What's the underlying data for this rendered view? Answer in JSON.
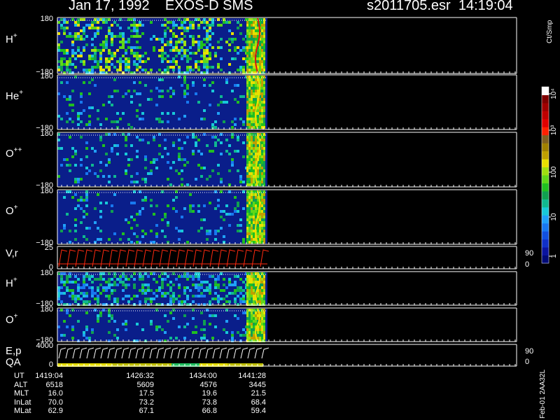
{
  "header": {
    "left_title": "Jan 17, 1992    EXOS-D SMS",
    "right_title": "s2011705.esr  14:19:04"
  },
  "colorbar": {
    "unit": "Ct/Smp",
    "tick_labels": [
      "1",
      "10",
      "100",
      "10³",
      "10⁴"
    ],
    "colors": [
      "#000a78",
      "#0a14a0",
      "#1030c8",
      "#1050e0",
      "#1878f0",
      "#20a0f8",
      "#18c8d8",
      "#10b890",
      "#10a050",
      "#20c020",
      "#60d818",
      "#a0e010",
      "#e8e000",
      "#c0a000",
      "#a08000",
      "#806020",
      "#ff2000",
      "#e00000",
      "#c00000",
      "#a00000",
      "#800000",
      "#ffffff"
    ]
  },
  "footer": {
    "stamp": "Feb-01 2AA32L"
  },
  "chart_data": {
    "type": "heatmap",
    "title": "Jan 17, 1992    EXOS-D SMS",
    "panels": [
      {
        "label_base": "H",
        "label_sup": "+",
        "y_top": "180",
        "y_bottom": "−180",
        "y_left_bottom": "−180"
      },
      {
        "label_base": "He",
        "label_sup": "+",
        "y_top": "180",
        "y_bottom": "−180"
      },
      {
        "label_base": "O",
        "label_sup": "++",
        "y_top": "180",
        "y_bottom": "−180"
      },
      {
        "label_base": "O",
        "label_sup": "+",
        "y_top": "180",
        "y_bottom": "−180"
      },
      {
        "label_base": "V,r",
        "label_sup": "",
        "y_top": "25",
        "y_bottom": "0",
        "right_top": "90",
        "right_bottom": "0",
        "kind": "line"
      },
      {
        "label_base": "H",
        "label_sup": "+",
        "y_top": "180",
        "y_bottom": "−180"
      },
      {
        "label_base": "O",
        "label_sup": "+",
        "y_top": "180",
        "y_bottom": "−180"
      },
      {
        "label_base": "E,p",
        "label2": "QA",
        "label_sup": "",
        "y_top": "4000",
        "y_bottom": "0",
        "right_top": "90",
        "right_bottom": "0",
        "kind": "line"
      }
    ],
    "x_ticks": [
      "1419:04",
      "1426:32",
      "1434:00",
      "1441:28"
    ],
    "ephemeris": [
      {
        "name": "UT",
        "values": [
          "1419:04",
          "1426:32",
          "1434:00",
          "1441:28"
        ]
      },
      {
        "name": "ALT",
        "values": [
          "6518",
          "5609",
          "4576",
          "3445"
        ]
      },
      {
        "name": "MLT",
        "values": [
          "16.0",
          "17.5",
          "19.6",
          "21.5"
        ]
      },
      {
        "name": "InLat",
        "values": [
          "70.0",
          "73.2",
          "73.8",
          "68.4"
        ]
      },
      {
        "name": "MLat",
        "values": [
          "62.9",
          "67.1",
          "66.8",
          "59.4"
        ]
      }
    ]
  }
}
